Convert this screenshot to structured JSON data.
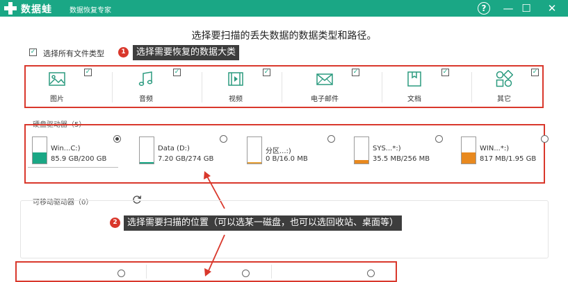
{
  "app": {
    "title": "数据蛙",
    "subtitle": "数据恢复专家",
    "help_label": "?",
    "minimize_label": "—",
    "maximize_label": "☐",
    "close_label": "✕",
    "accent_color": "#1aa785"
  },
  "heading": "选择要扫描的丢失数据的数据类型和路径。",
  "select_all": {
    "label": "选择所有文件类型",
    "checked": true
  },
  "file_types": [
    {
      "label": "图片",
      "icon": "image-icon",
      "checked": true
    },
    {
      "label": "音频",
      "icon": "music-icon",
      "checked": true
    },
    {
      "label": "视频",
      "icon": "video-icon",
      "checked": true
    },
    {
      "label": "电子邮件",
      "icon": "mail-icon",
      "checked": true
    },
    {
      "label": "文档",
      "icon": "document-icon",
      "checked": true
    },
    {
      "label": "其它",
      "icon": "other-icon",
      "checked": true
    }
  ],
  "hard_drives": {
    "title": "硬盘驱动器（5）",
    "items": [
      {
        "name": "Win...C:)",
        "size": "85.9 GB/200 GB",
        "used_fraction": 0.43,
        "fill_color": "#1aa785",
        "selected": true
      },
      {
        "name": "Data (D:)",
        "size": "7.20 GB/274 GB",
        "used_fraction": 0.03,
        "fill_color": "#1aa785",
        "selected": false
      },
      {
        "name": "分区...:)",
        "size": "0  B/16.0 MB",
        "used_fraction": 0.0,
        "fill_color": "#e8a23a",
        "selected": false
      },
      {
        "name": "SYS...*:)",
        "size": "35.5 MB/256 MB",
        "used_fraction": 0.14,
        "fill_color": "#e8891f",
        "selected": false
      },
      {
        "name": "WIN...*:)",
        "size": "817 MB/1.95 GB",
        "used_fraction": 0.41,
        "fill_color": "#e8891f",
        "selected": false
      }
    ]
  },
  "removable": {
    "title": "可移动驱动器（0）",
    "refresh_icon": "refresh-icon"
  },
  "annotations": [
    {
      "number": "1",
      "text": "选择需要恢复的数据大类"
    },
    {
      "number": "2",
      "text": "选择需要扫描的位置（可以选某一磁盘，也可以选回收站、桌面等）"
    }
  ]
}
